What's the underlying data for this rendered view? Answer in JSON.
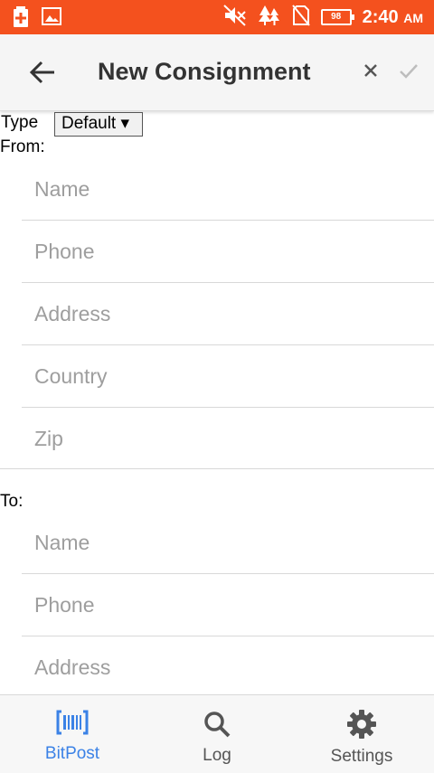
{
  "status_bar": {
    "battery_level": "98",
    "time": "2:40",
    "ampm": "AM",
    "color": "#f4511e"
  },
  "app_bar": {
    "title": "New Consignment"
  },
  "form": {
    "type_label": "Type",
    "type_value": "Default ▾",
    "from_label": "From:",
    "from_fields": [
      {
        "placeholder": "Name"
      },
      {
        "placeholder": "Phone"
      },
      {
        "placeholder": "Address"
      },
      {
        "placeholder": "Country"
      },
      {
        "placeholder": "Zip"
      }
    ],
    "to_label": "To:",
    "to_fields": [
      {
        "placeholder": "Name"
      },
      {
        "placeholder": "Phone"
      },
      {
        "placeholder": "Address"
      }
    ]
  },
  "bottom_nav": {
    "items": [
      {
        "label": "BitPost",
        "icon": "barcode-icon",
        "active": true
      },
      {
        "label": "Log",
        "icon": "search-icon",
        "active": false
      },
      {
        "label": "Settings",
        "icon": "gear-icon",
        "active": false
      }
    ],
    "active_color": "#3b82e6",
    "inactive_color": "#555555"
  }
}
